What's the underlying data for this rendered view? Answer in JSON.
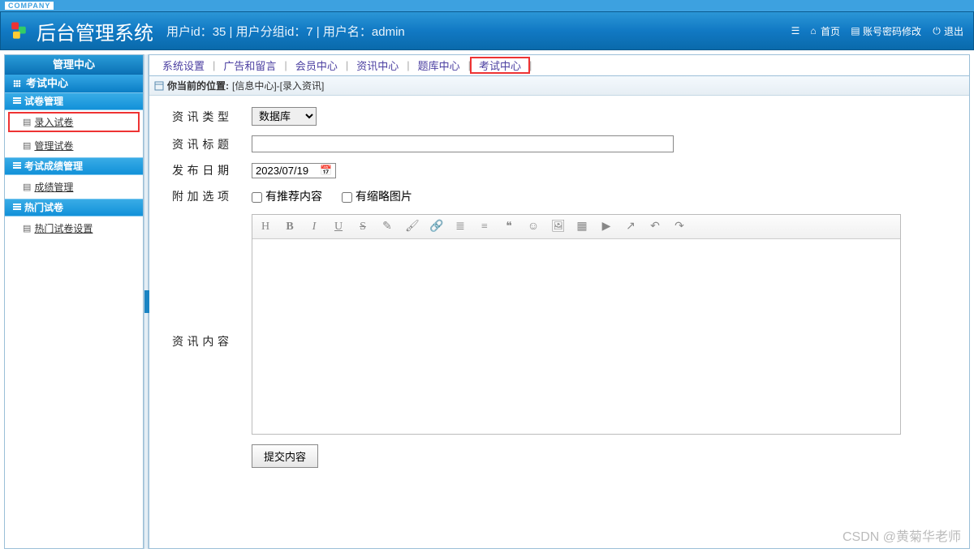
{
  "company_tag": "COMPANY",
  "app_title": "后台管理系统",
  "user_info": {
    "uid_label": "用户id：",
    "uid": "35",
    "sep1": " | ",
    "gid_label": "用户分组id：",
    "gid": "7",
    "sep2": " | ",
    "uname_label": "用户名：",
    "uname": "admin"
  },
  "header_links": {
    "home": "首页",
    "pwd": "账号密码修改",
    "logout": "退出"
  },
  "sidebar": {
    "center_title": "管理中心",
    "section_title": "考试中心",
    "groups": [
      {
        "title": "试卷管理",
        "items": [
          {
            "label": "录入试卷",
            "highlight": true
          },
          {
            "label": "管理试卷",
            "highlight": false
          }
        ]
      },
      {
        "title": "考试成绩管理",
        "items": [
          {
            "label": "成绩管理",
            "highlight": false
          }
        ]
      },
      {
        "title": "热门试卷",
        "items": [
          {
            "label": "热门试卷设置",
            "highlight": false
          }
        ]
      }
    ]
  },
  "topnav": [
    {
      "label": "系统设置",
      "highlight": false
    },
    {
      "label": "广告和留言",
      "highlight": false
    },
    {
      "label": "会员中心",
      "highlight": false
    },
    {
      "label": "资讯中心",
      "highlight": false
    },
    {
      "label": "题库中心",
      "highlight": false
    },
    {
      "label": "考试中心",
      "highlight": true
    }
  ],
  "breadcrumb": {
    "prefix": "你当前的位置:",
    "path": "[信息中心]-[录入资讯]"
  },
  "form": {
    "type_label": "资讯类型",
    "type_value": "数据库",
    "title_label": "资讯标题",
    "title_value": "",
    "date_label": "发布日期",
    "date_value": "2023/07/19",
    "extra_label": "附加选项",
    "cb1": "有推荐内容",
    "cb2": "有缩略图片",
    "content_label": "资讯内容",
    "content_value": "",
    "submit": "提交内容"
  },
  "editor_icons": {
    "h": "H",
    "b": "B",
    "i": "I",
    "u": "U",
    "s": "S",
    "eraser": "✎",
    "brush": "🖌",
    "link": "🔗",
    "list": "≣",
    "align": "≡",
    "quote": "❝",
    "emoji": "☺",
    "image": "🖼",
    "table": "▦",
    "video": "▶",
    "arrow": "↗",
    "undo": "↶",
    "redo": "↷"
  },
  "watermark": "CSDN @黄菊华老师"
}
